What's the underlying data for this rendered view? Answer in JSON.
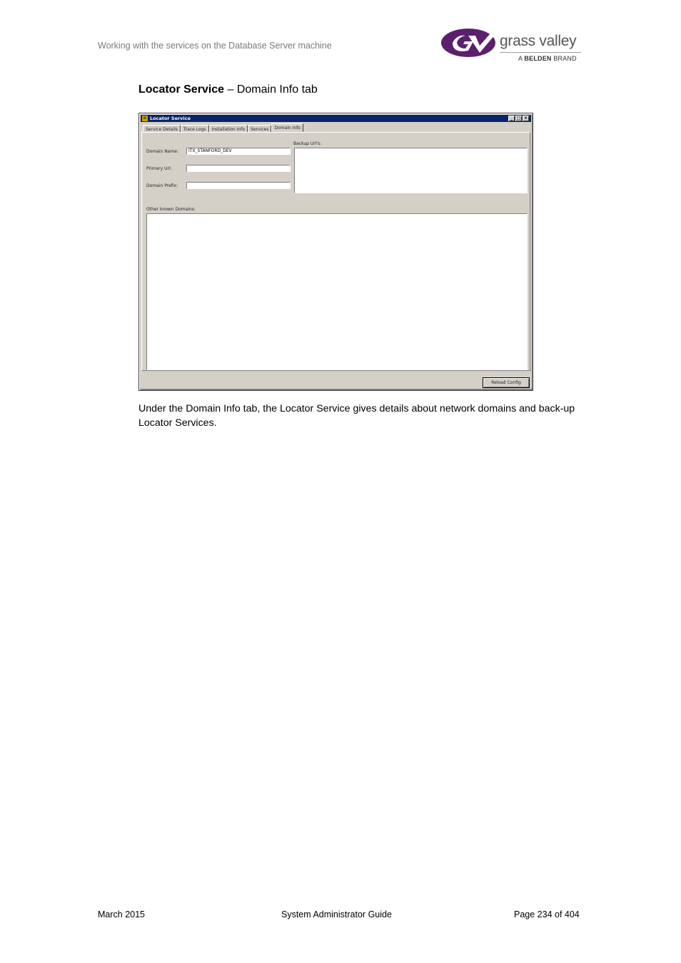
{
  "header": {
    "running_title": "Working with the services on the Database Server machine",
    "logo_word": "grass valley",
    "logo_brand_prefix": "A",
    "logo_brand_bold": "BELDEN",
    "logo_brand_suffix": "BRAND",
    "logo_icon": "gv-swoosh-icon",
    "logo_color": "#5b1f6e"
  },
  "caption": {
    "bold": "Locator Service",
    "rest": " – Domain Info tab"
  },
  "dialog": {
    "title": "Locator Service",
    "title_icon": "app-icon",
    "window_buttons": {
      "minimize": "_",
      "maximize": "□",
      "close": "×"
    },
    "tabs": [
      {
        "label": "Service Details",
        "active": false
      },
      {
        "label": "Trace Logs",
        "active": false
      },
      {
        "label": "Installation Info",
        "active": false
      },
      {
        "label": "Services",
        "active": false
      },
      {
        "label": "Domain Info",
        "active": true
      }
    ],
    "domain_name_label": "Domain Name:",
    "domain_name_value": "ITX_STANFORD_DEV",
    "primary_url_label": "Primary Url:",
    "primary_url_value": "",
    "domain_prefix_label": "Domain Prefix:",
    "domain_prefix_value": "",
    "backup_urls_label": "Backup Url's:",
    "other_domains_label": "Other known Domains:",
    "reload_button": "Reload Config",
    "title_color": "#0a246a",
    "face_color": "#d4d0c8"
  },
  "body": {
    "paragraph": "Under the Domain Info tab, the Locator Service gives details about network domains and back-up Locator Services."
  },
  "footer": {
    "left": "March 2015",
    "center": "System Administrator Guide",
    "right": "Page 234 of 404"
  }
}
